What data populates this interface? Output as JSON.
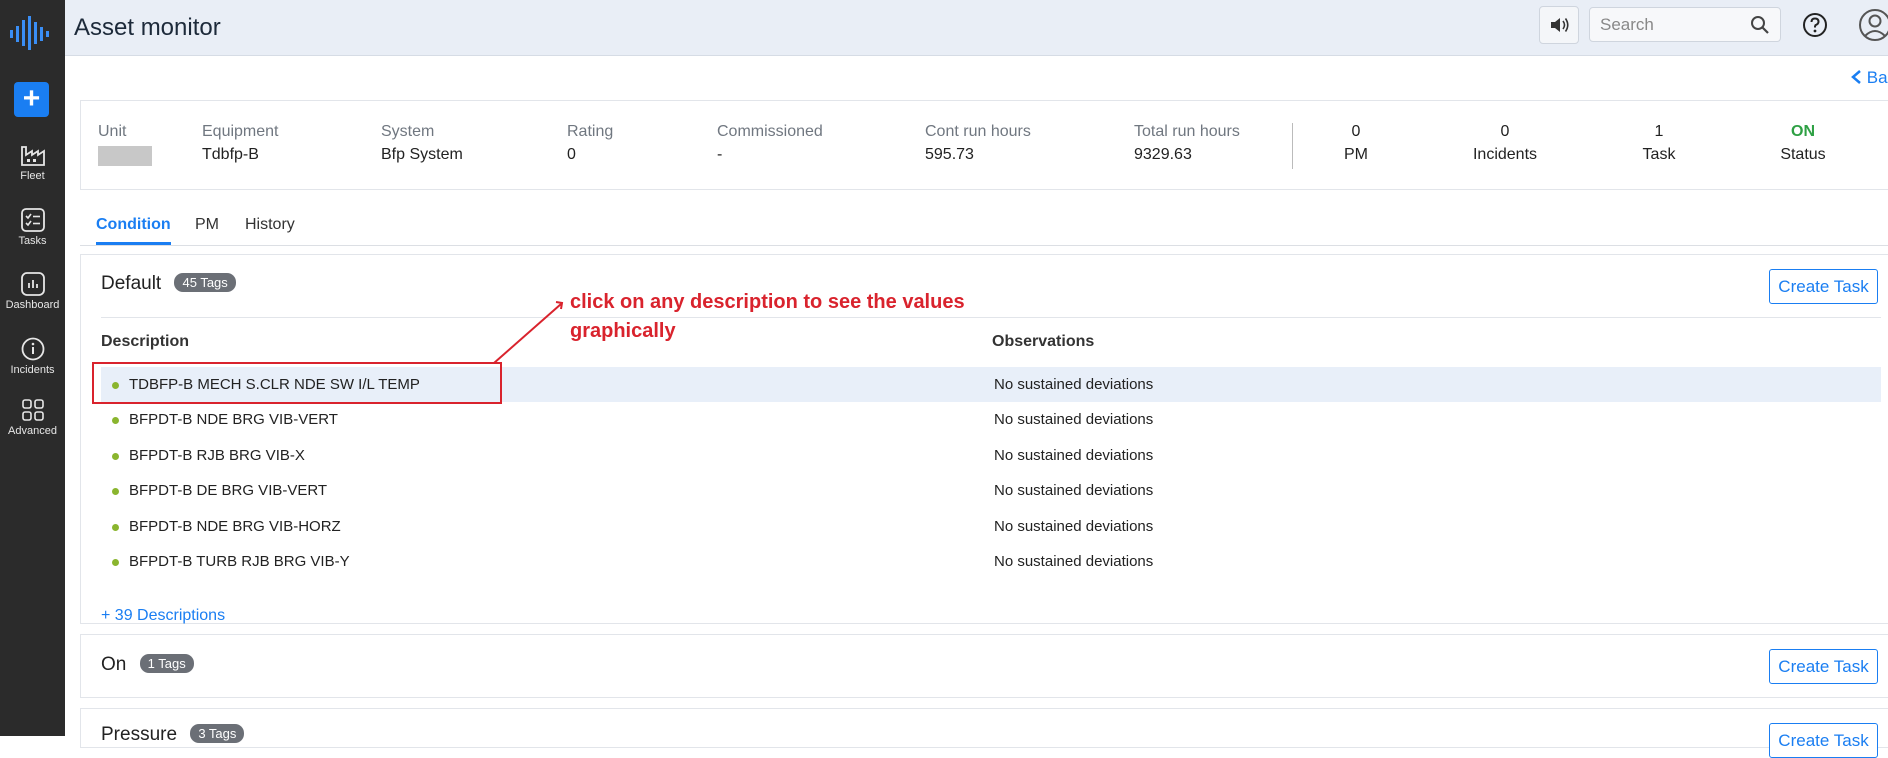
{
  "app": {
    "title": "Asset monitor"
  },
  "sidebar": {
    "items": [
      {
        "label": "Fleet"
      },
      {
        "label": "Tasks"
      },
      {
        "label": "Dashboard"
      },
      {
        "label": "Incidents"
      },
      {
        "label": "Advanced"
      }
    ]
  },
  "header": {
    "search_placeholder": "Search",
    "back_label": "Bac"
  },
  "summary": {
    "unit": {
      "label": "Unit"
    },
    "equipment": {
      "label": "Equipment",
      "value": "Tdbfp-B"
    },
    "system": {
      "label": "System",
      "value": "Bfp System"
    },
    "rating": {
      "label": "Rating",
      "value": "0"
    },
    "commissioned": {
      "label": "Commissioned",
      "value": "-"
    },
    "cont_run_hours": {
      "label": "Cont run hours",
      "value": "595.73"
    },
    "total_run_hours": {
      "label": "Total run hours",
      "value": "9329.63"
    },
    "stats": {
      "pm": {
        "value": "0",
        "label": "PM"
      },
      "incidents": {
        "value": "0",
        "label": "Incidents"
      },
      "task": {
        "value": "1",
        "label": "Task"
      },
      "status": {
        "value": "ON",
        "label": "Status"
      }
    }
  },
  "tabs": [
    {
      "label": "Condition"
    },
    {
      "label": "PM"
    },
    {
      "label": "History"
    }
  ],
  "panels": {
    "default": {
      "title": "Default",
      "badge": "45 Tags",
      "create_label": "Create Task",
      "col_description": "Description",
      "col_observations": "Observations",
      "rows": [
        {
          "description": "TDBFP-B MECH S.CLR NDE SW I/L TEMP",
          "observation": "No sustained deviations"
        },
        {
          "description": "BFPDT-B NDE BRG VIB-VERT",
          "observation": "No sustained deviations"
        },
        {
          "description": "BFPDT-B RJB BRG VIB-X",
          "observation": "No sustained deviations"
        },
        {
          "description": "BFPDT-B DE BRG VIB-VERT",
          "observation": "No sustained deviations"
        },
        {
          "description": "BFPDT-B NDE BRG VIB-HORZ",
          "observation": "No sustained deviations"
        },
        {
          "description": "BFPDT-B TURB RJB BRG VIB-Y",
          "observation": "No sustained deviations"
        }
      ],
      "more_label": "+ 39 Descriptions"
    },
    "on": {
      "title": "On",
      "badge": "1 Tags",
      "create_label": "Create Task"
    },
    "pressure": {
      "title": "Pressure",
      "badge": "3 Tags",
      "create_label": "Create Task"
    }
  },
  "annotation": {
    "text": "click on any description to see the values graphically",
    "color": "#d9232d"
  },
  "colors": {
    "accent": "#1a7ef2",
    "status_on": "#2ea044",
    "sidebar": "#2b2b2b"
  }
}
